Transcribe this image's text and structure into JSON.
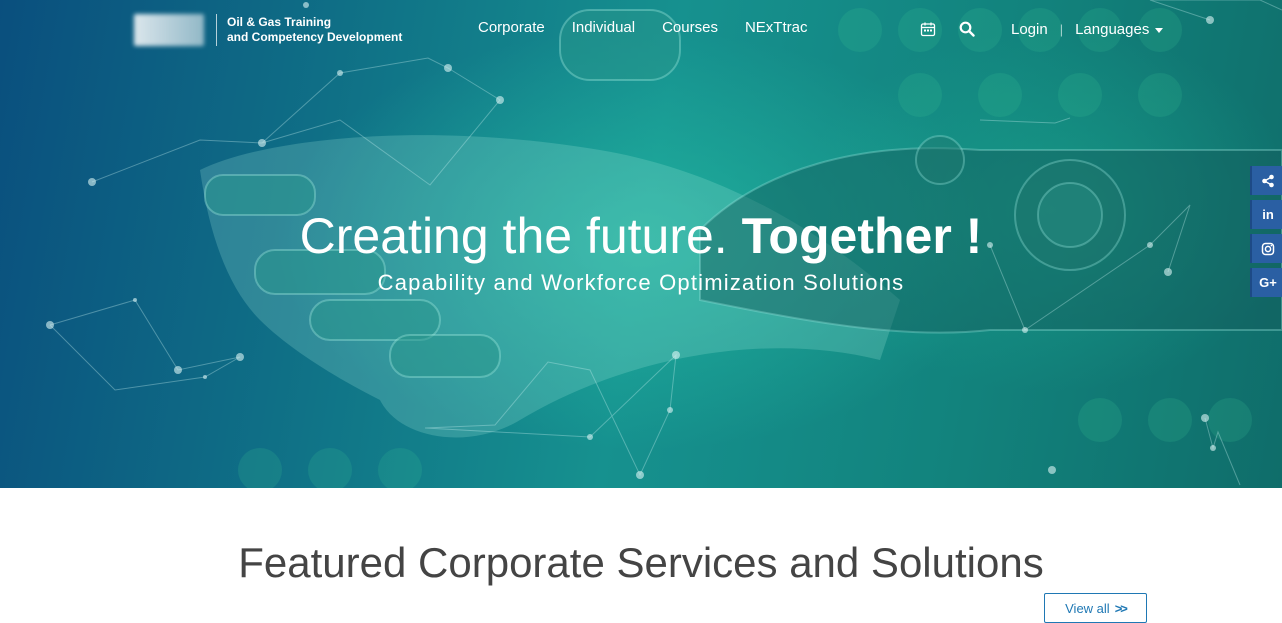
{
  "brand": {
    "logo_line1": "Oil & Gas Training",
    "logo_line2": "and Competency Development"
  },
  "nav": {
    "items": [
      {
        "label": "Corporate"
      },
      {
        "label": "Individual"
      },
      {
        "label": "Courses"
      },
      {
        "label": "NExTtrac"
      }
    ]
  },
  "header_actions": {
    "calendar_icon": "calendar-icon",
    "search_icon": "search-icon",
    "login_label": "Login",
    "divider": "|",
    "languages_label": "Languages"
  },
  "hero": {
    "headline_regular": "Creating the future. ",
    "headline_bold": "Together !",
    "subheadline": "Capability and Workforce Optimization Solutions"
  },
  "social": {
    "items": [
      {
        "icon": "share-icon",
        "glyph": "<"
      },
      {
        "icon": "linkedin-icon",
        "glyph": "in"
      },
      {
        "icon": "instagram-icon",
        "glyph": "◎"
      },
      {
        "icon": "google-plus-icon",
        "glyph": "G+"
      }
    ]
  },
  "featured": {
    "title": "Featured Corporate Services and Solutions",
    "view_all_label": "View all",
    "view_all_chevron": ">>"
  },
  "colors": {
    "hero_teal": "#16918f",
    "hero_blue": "#0a4f7e",
    "social_blue": "#2a5fa3",
    "link_blue": "#1f78b4",
    "title_gray": "#444444"
  }
}
